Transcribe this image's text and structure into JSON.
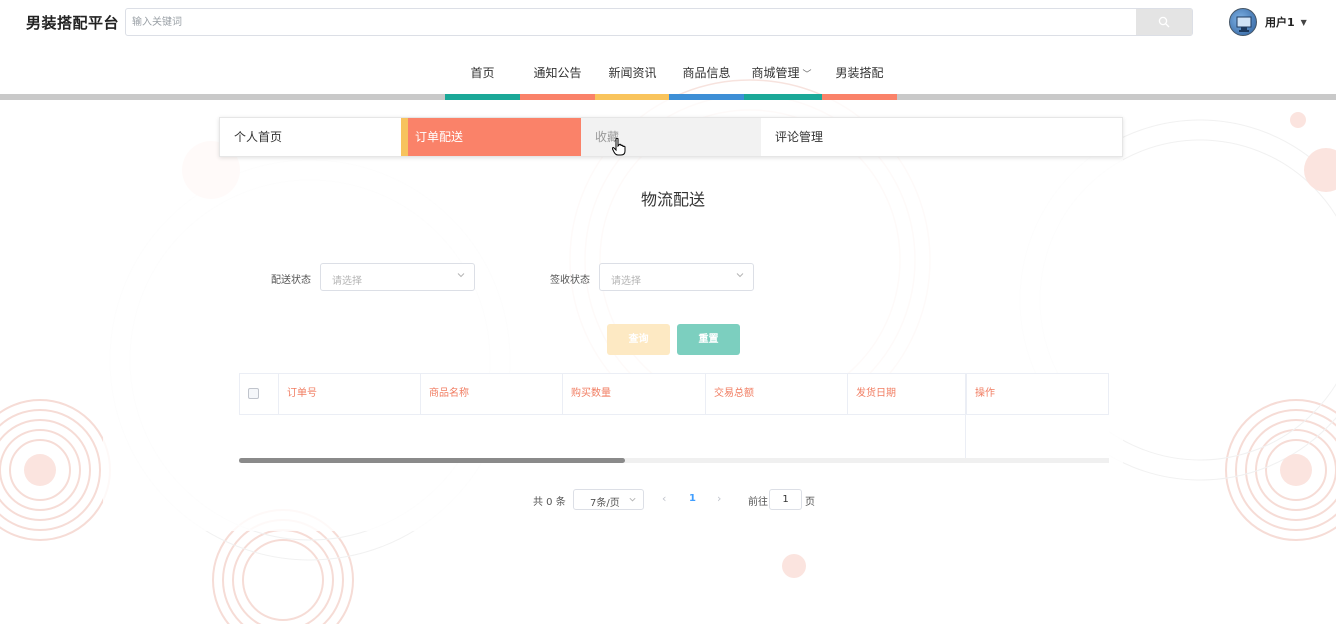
{
  "header": {
    "logo": "男装搭配平台",
    "search_placeholder": "输入关键词",
    "username": "用户1"
  },
  "nav": {
    "items": [
      {
        "label": "首页",
        "color": "#1aa898"
      },
      {
        "label": "通知公告",
        "color": "#fa8269"
      },
      {
        "label": "新闻资讯",
        "color": "#f9c45c"
      },
      {
        "label": "商品信息",
        "color": "#3d8fd6"
      },
      {
        "label": "商城管理",
        "color": "#1aa898"
      },
      {
        "label": "男装搭配",
        "color": "#fa8269"
      }
    ]
  },
  "tabs": {
    "items": [
      "个人首页",
      "订单配送",
      "收藏",
      "评论管理"
    ],
    "active": "订单配送"
  },
  "page": {
    "title": "物流配送"
  },
  "filters": {
    "delivery_status_label": "配送状态",
    "delivery_status_placeholder": "请选择",
    "sign_status_label": "签收状态",
    "sign_status_placeholder": "请选择",
    "query_button": "查询",
    "reset_button": "重置"
  },
  "table": {
    "columns": [
      "订单号",
      "商品名称",
      "购买数量",
      "交易总额",
      "发货日期",
      "操作"
    ],
    "rows": []
  },
  "pagination": {
    "total": "共 0 条",
    "page_size": "7条/页",
    "current_page": "1",
    "goto_label": "前往",
    "goto_value": "1",
    "page_suffix": "页"
  },
  "colors": {
    "accent": "#fa8269",
    "teal": "#1aa898",
    "yellow": "#f9c45c",
    "blue": "#3d8fd6"
  }
}
